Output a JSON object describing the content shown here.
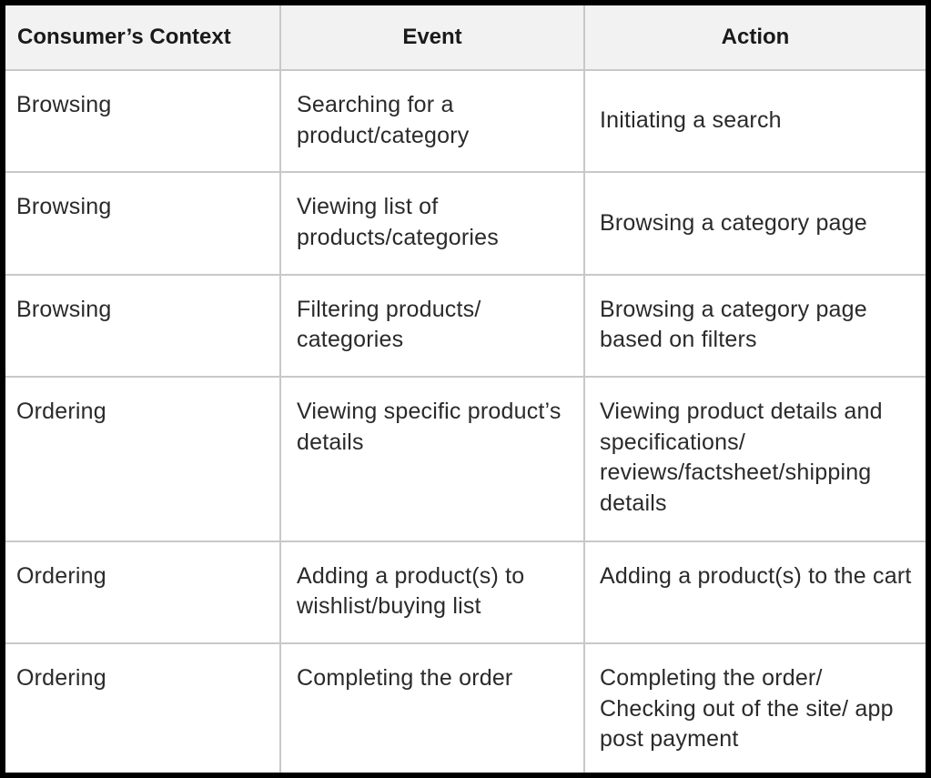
{
  "table": {
    "headers": [
      "Consumer’s Context",
      "Event",
      "Action"
    ],
    "rows": [
      {
        "context": "Browsing",
        "event": "Searching for a product/category",
        "action": "Initiating a search"
      },
      {
        "context": "Browsing",
        "event": "Viewing list of products/categories",
        "action": "Browsing a category page"
      },
      {
        "context": "Browsing",
        "event": "Filtering products/ categories",
        "action": "Browsing a category page based on filters"
      },
      {
        "context": "Ordering",
        "event": "Viewing specific product’s details",
        "action": "Viewing product details and specifications/ reviews/factsheet/shipping details"
      },
      {
        "context": "Ordering",
        "event": "Adding a product(s) to wishlist/buying list",
        "action": "Adding a product(s) to the cart"
      },
      {
        "context": "Ordering",
        "event": "Completing the order",
        "action": "Completing the order/ Checking out of the site/ app post payment"
      }
    ]
  },
  "colors": {
    "frame": "#000000",
    "header_bg": "#f2f2f2",
    "grid": "#c8c8c8",
    "text": "#2a2a2a"
  }
}
